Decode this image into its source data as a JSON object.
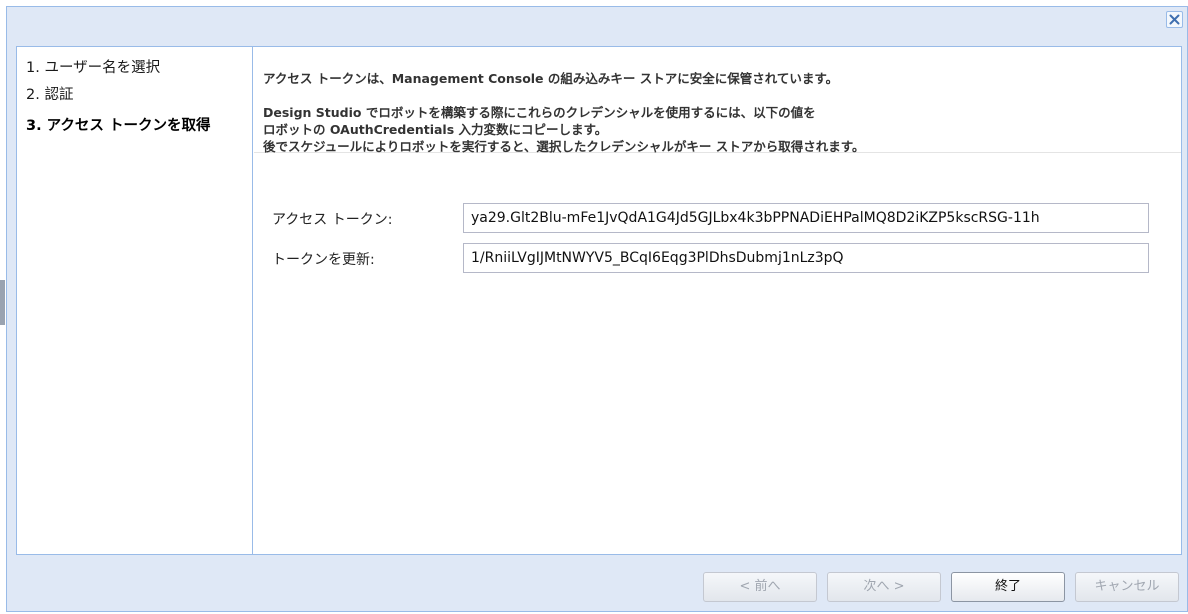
{
  "close_label": "×",
  "steps": [
    {
      "label": "1. ユーザー名を選択"
    },
    {
      "label": "2. 認証"
    },
    {
      "label": "3. アクセス トークンを取得"
    }
  ],
  "info": {
    "line1": "アクセス トークンは、Management Console の組み込みキー ストアに安全に保管されています。",
    "line2": "Design Studio でロボットを構築する際にこれらのクレデンシャルを使用するには、以下の値を",
    "line3": "ロボットの OAuthCredentials 入力変数にコピーします。",
    "line4": "後でスケジュールによりロボットを実行すると、選択したクレデンシャルがキー ストアから取得されます。"
  },
  "fields": {
    "access_token_label": "アクセス トークン:",
    "access_token_value": "ya29.Glt2Blu-mFe1JvQdA1G4Jd5GJLbx4k3bPPNADiEHPalMQ8D2iKZP5kscRSG-11h",
    "refresh_token_label": "トークンを更新:",
    "refresh_token_value": "1/RniiLVgIJMtNWYV5_BCqI6Eqg3PlDhsDubmj1nLz3pQ"
  },
  "buttons": {
    "prev": "< 前へ",
    "next": "次へ >",
    "finish": "終了",
    "cancel": "キャンセル"
  },
  "colors": {
    "frame_border": "#99bbe8",
    "dialog_bg": "#dfe8f6"
  }
}
